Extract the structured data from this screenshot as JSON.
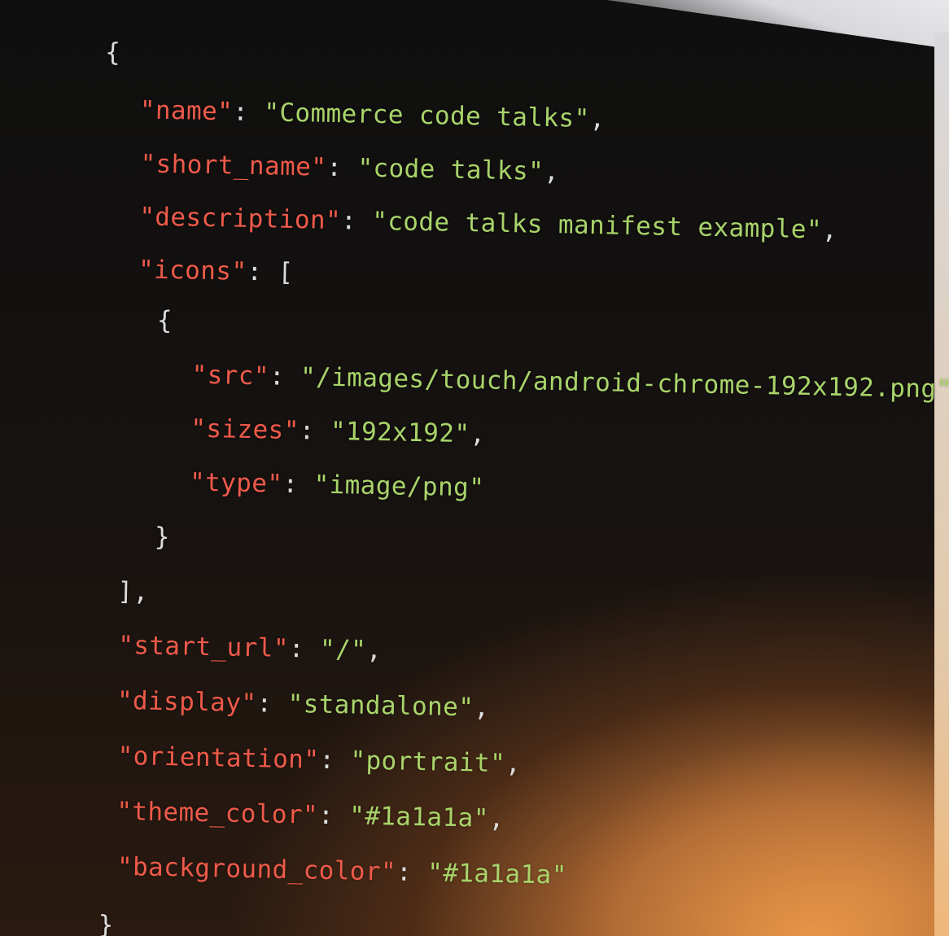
{
  "code": {
    "open_brace": "{",
    "name_key": "\"name\"",
    "name_value": "\"Commerce code talks\"",
    "short_name_key": "\"short_name\"",
    "short_name_value": "\"code talks\"",
    "description_key": "\"description\"",
    "description_value": "\"code talks manifest example\"",
    "icons_key": "\"icons\"",
    "icons_open": "[",
    "icon_obj_open": "{",
    "src_key": "\"src\"",
    "src_value": "\"/images/touch/android-chrome-192x192.png\"",
    "sizes_key": "\"sizes\"",
    "sizes_value": "\"192x192\"",
    "type_key": "\"type\"",
    "type_value": "\"image/png\"",
    "icon_obj_close": "}",
    "icons_close": "],",
    "start_url_key": "\"start_url\"",
    "start_url_value": "\"/\"",
    "display_key": "\"display\"",
    "display_value": "\"standalone\"",
    "orientation_key": "\"orientation\"",
    "orientation_value": "\"portrait\"",
    "theme_color_key": "\"theme_color\"",
    "theme_color_value": "\"#1a1a1a\"",
    "background_color_key": "\"background_color\"",
    "background_color_value": "\"#1a1a1a\"",
    "close_brace": "}"
  },
  "colors": {
    "key": "#ee5a4a",
    "string": "#a9d46a",
    "punctuation": "#dcdcdc",
    "background": "#101010"
  }
}
